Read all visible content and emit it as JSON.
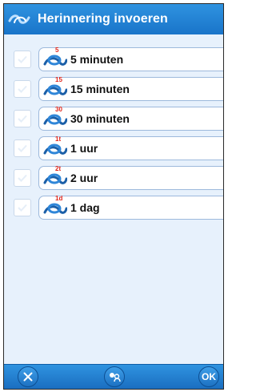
{
  "header": {
    "title": "Herinnering invoeren"
  },
  "reminders": [
    {
      "superscript": "5",
      "label": "5 minuten"
    },
    {
      "superscript": "15",
      "label": "15 minuten"
    },
    {
      "superscript": "30",
      "label": "30 minuten"
    },
    {
      "superscript": "1t",
      "label": "1 uur"
    },
    {
      "superscript": "2t",
      "label": "2 uur"
    },
    {
      "superscript": "1d",
      "label": "1 dag"
    }
  ],
  "toolbar": {
    "ok_label": "OK"
  },
  "icons": {
    "header": "knot-logo-icon",
    "item": "knot-icon",
    "cancel": "close-icon",
    "contacts": "contacts-icon",
    "checkbox": "checkmark-icon"
  },
  "colors": {
    "accent": "#1f7ed2",
    "reminder_red": "#e0261c"
  }
}
